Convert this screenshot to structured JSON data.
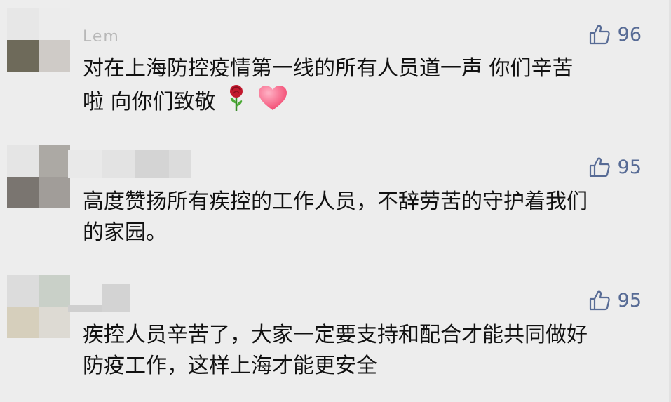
{
  "comments": [
    {
      "nickname": "Lem",
      "likes": "96",
      "text_line1": "对在上海防控疫情第一线的所有人员道一声 你们辛苦",
      "text_line2": "啦 向你们致敬",
      "emojis": [
        "rose-emoji",
        "heart-emoji"
      ]
    },
    {
      "nickname": "",
      "likes": "95",
      "text_line1": "高度赞扬所有疾控的工作人员，不辞劳苦的守护着我们",
      "text_line2": "的家园。"
    },
    {
      "nickname": "",
      "likes": "95",
      "text_line1": "疾控人员辛苦了，大家一定要支持和配合才能共同做好",
      "text_line2": "防疫工作，这样上海才能更安全"
    }
  ],
  "colors": {
    "background": "#ededed",
    "like_blue": "#576b95",
    "text": "#111111"
  },
  "icons": [
    "thumbs-up-icon"
  ]
}
